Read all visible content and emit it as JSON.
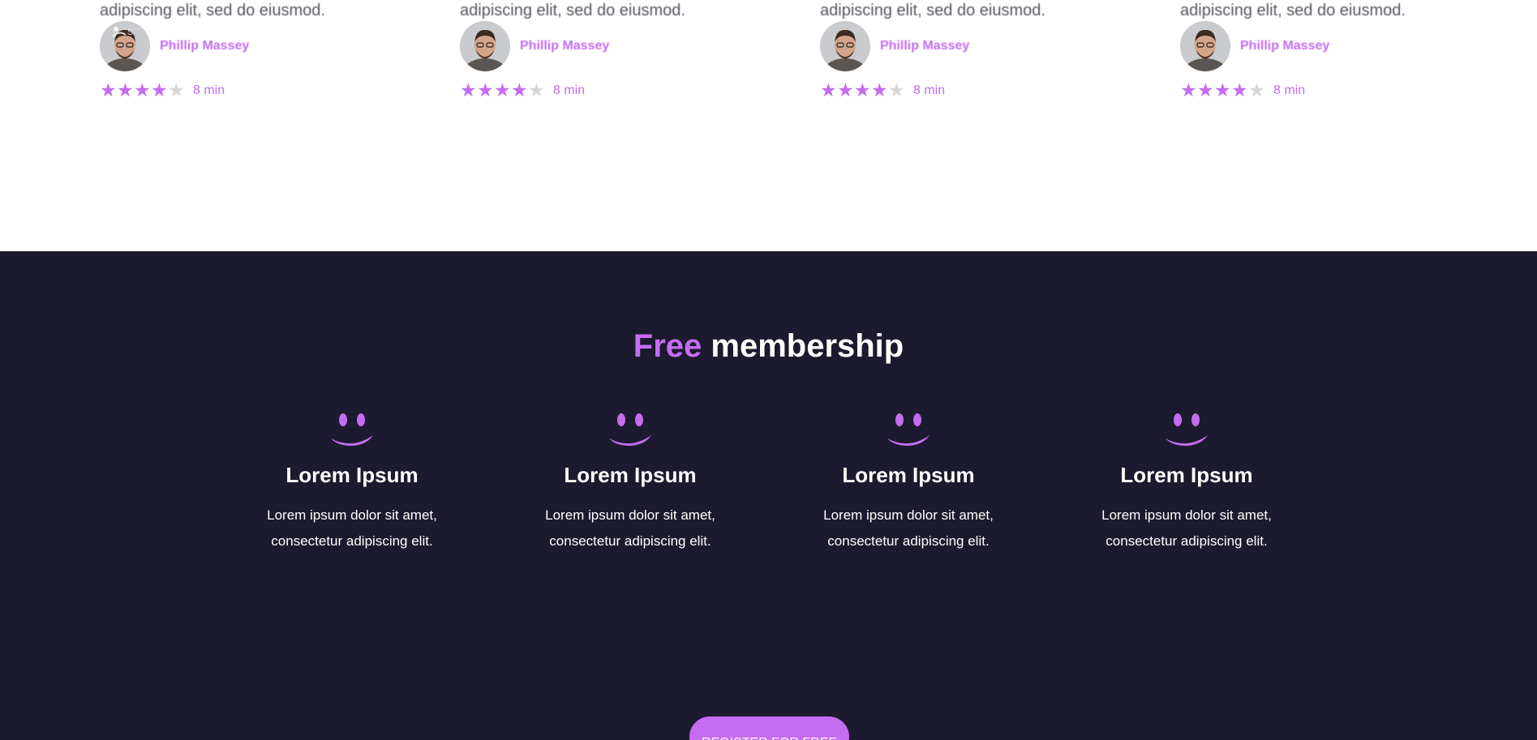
{
  "colors": {
    "accent": "#c56cf0",
    "dark_bg": "#1c1a2e",
    "star_off": "#d6d6d6"
  },
  "cards": [
    {
      "excerpt": "adipiscing elit, sed do eiusmod.",
      "author": "Phillip Massey",
      "rating": 4,
      "rating_max": 5,
      "read_time": "8 min"
    },
    {
      "excerpt": "adipiscing elit, sed do eiusmod.",
      "author": "Phillip Massey",
      "rating": 4,
      "rating_max": 5,
      "read_time": "8 min"
    },
    {
      "excerpt": "adipiscing elit, sed do eiusmod.",
      "author": "Phillip Massey",
      "rating": 4,
      "rating_max": 5,
      "read_time": "8 min"
    },
    {
      "excerpt": "adipiscing elit, sed do eiusmod.",
      "author": "Phillip Massey",
      "rating": 4,
      "rating_max": 5,
      "read_time": "8 min"
    }
  ],
  "membership": {
    "title_accent": "Free",
    "title_rest": " membership",
    "features": [
      {
        "icon": "smiley-icon",
        "title": "Lorem Ipsum",
        "desc_line1": "Lorem ipsum dolor sit amet,",
        "desc_line2": "consectetur adipiscing elit."
      },
      {
        "icon": "smiley-icon",
        "title": "Lorem Ipsum",
        "desc_line1": "Lorem ipsum dolor sit amet,",
        "desc_line2": "consectetur adipiscing elit."
      },
      {
        "icon": "smiley-icon",
        "title": "Lorem Ipsum",
        "desc_line1": "Lorem ipsum dolor sit amet,",
        "desc_line2": "consectetur adipiscing elit."
      },
      {
        "icon": "smiley-icon",
        "title": "Lorem Ipsum",
        "desc_line1": "Lorem ipsum dolor sit amet,",
        "desc_line2": "consectetur adipiscing elit."
      }
    ],
    "register_label": "Register for free"
  }
}
